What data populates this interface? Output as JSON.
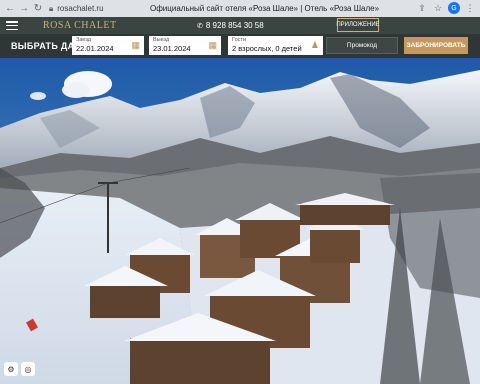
{
  "browser": {
    "url": "rosachalet.ru",
    "tab_title": "Официальный сайт отеля «Роза Шале» | Отель «Роза Шале»",
    "nav_icons": [
      "back-icon",
      "forward-icon",
      "reload-icon"
    ],
    "right_icons": [
      "share-icon",
      "star-icon",
      "extension-icon",
      "menu-icon"
    ]
  },
  "header": {
    "logo": "ROSA CHALET",
    "phone": "8 928 854 30 58",
    "lang_button": "ПРИЛОЖЕНИЕ"
  },
  "booking": {
    "title": "ВЫБРАТЬ ДАТЫ",
    "checkin": {
      "label": "Заезд",
      "value": "22.01.2024"
    },
    "checkout": {
      "label": "Выезд",
      "value": "23.01.2024"
    },
    "guests": {
      "label": "Гости",
      "value": "2 взрослых, 0 детей"
    },
    "promo_label": "Промокод",
    "book_label": "ЗАБРОНИРОВАТЬ"
  },
  "colors": {
    "header_bg": "#3a4541",
    "booking_bg": "#2e3735",
    "accent_gold": "#c49a5c"
  }
}
